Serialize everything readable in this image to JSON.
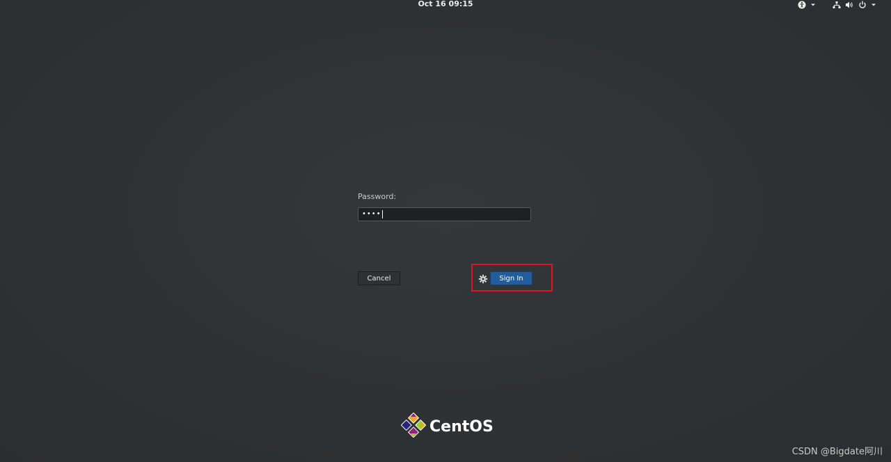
{
  "topbar": {
    "clock": "Oct 16  09:15",
    "icons": [
      "accessibility-icon",
      "chevron-down-icon",
      "network-icon",
      "volume-icon",
      "power-icon",
      "chevron-down-icon"
    ]
  },
  "login": {
    "password_label": "Password:",
    "password_value": "••••",
    "cancel_label": "Cancel",
    "signin_label": "Sign In",
    "settings_icon": "gear-icon"
  },
  "branding": {
    "logo_text": "CentOS"
  },
  "watermark": "CSDN @Bigdate阿川",
  "colors": {
    "background": "#2e3133",
    "signin_button": "#215d9c",
    "highlight_box": "#e0141e"
  }
}
